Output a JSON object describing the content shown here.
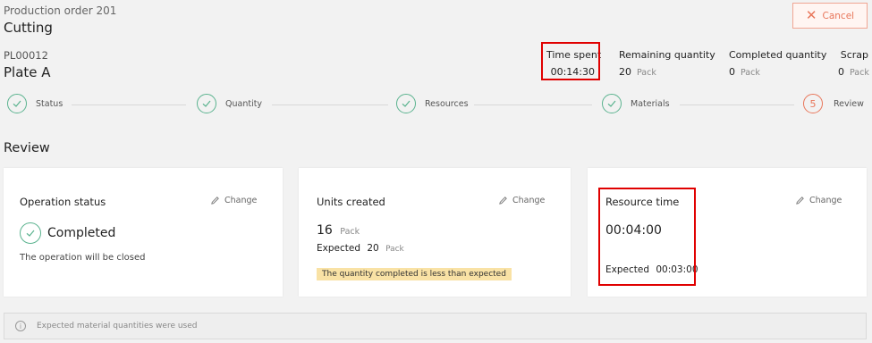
{
  "header": {
    "order_title": "Production order 201",
    "operation_title": "Cutting",
    "cancel_label": "Cancel"
  },
  "product": {
    "code": "PL00012",
    "name": "Plate A"
  },
  "stats": {
    "time_spent": {
      "label": "Time spent",
      "value": "00:14:30"
    },
    "remaining": {
      "label": "Remaining quantity",
      "value": "20",
      "unit": "Pack"
    },
    "completed": {
      "label": "Completed quantity",
      "value": "0",
      "unit": "Pack"
    },
    "scrap": {
      "label": "Scrap",
      "value": "0",
      "unit": "Pack"
    }
  },
  "steps": [
    {
      "label": "Status",
      "state": "done"
    },
    {
      "label": "Quantity",
      "state": "done"
    },
    {
      "label": "Resources",
      "state": "done"
    },
    {
      "label": "Materials",
      "state": "done"
    },
    {
      "label": "Review",
      "state": "current",
      "number": "5"
    }
  ],
  "review": {
    "heading": "Review",
    "operation_status": {
      "title": "Operation status",
      "change_label": "Change",
      "status": "Completed",
      "note": "The operation will be closed"
    },
    "units_created": {
      "title": "Units created",
      "change_label": "Change",
      "value": "16",
      "unit": "Pack",
      "expected_label": "Expected",
      "expected_value": "20",
      "expected_unit": "Pack",
      "warning": "The quantity completed is less than expected"
    },
    "resource_time": {
      "title": "Resource time",
      "change_label": "Change",
      "value": "00:04:00",
      "expected_label": "Expected",
      "expected_value": "00:03:00"
    }
  },
  "info": {
    "text": "Expected material quantities were used"
  },
  "colors": {
    "accent_orange": "#e8765a",
    "check_green": "#5bb38f",
    "highlight_red": "#e00000",
    "warning_yellow": "#f9e2a5"
  }
}
